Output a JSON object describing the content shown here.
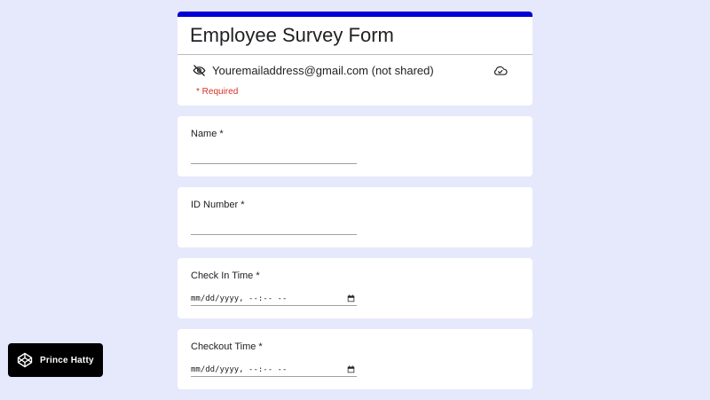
{
  "form": {
    "title": "Employee Survey Form",
    "email": "Youremailaddress@gmail.com (not shared)",
    "required_note": "* Required",
    "accent_color": "#0000d6",
    "icons": {
      "visibility": "eye-off-icon",
      "cloud": "cloud-done-icon",
      "calendar": "calendar-icon"
    },
    "questions": [
      {
        "label": "Name *",
        "type": "text",
        "value": ""
      },
      {
        "label": "ID Number *",
        "type": "text",
        "value": ""
      },
      {
        "label": "Check In Time *",
        "type": "datetime",
        "placeholder": "mm/dd/yyyy, --:-- --"
      },
      {
        "label": "Checkout Time *",
        "type": "datetime",
        "placeholder": "mm/dd/yyyy, --:-- --"
      }
    ]
  },
  "badge": {
    "label": "Prince Hatty",
    "icon": "codepen-icon"
  }
}
